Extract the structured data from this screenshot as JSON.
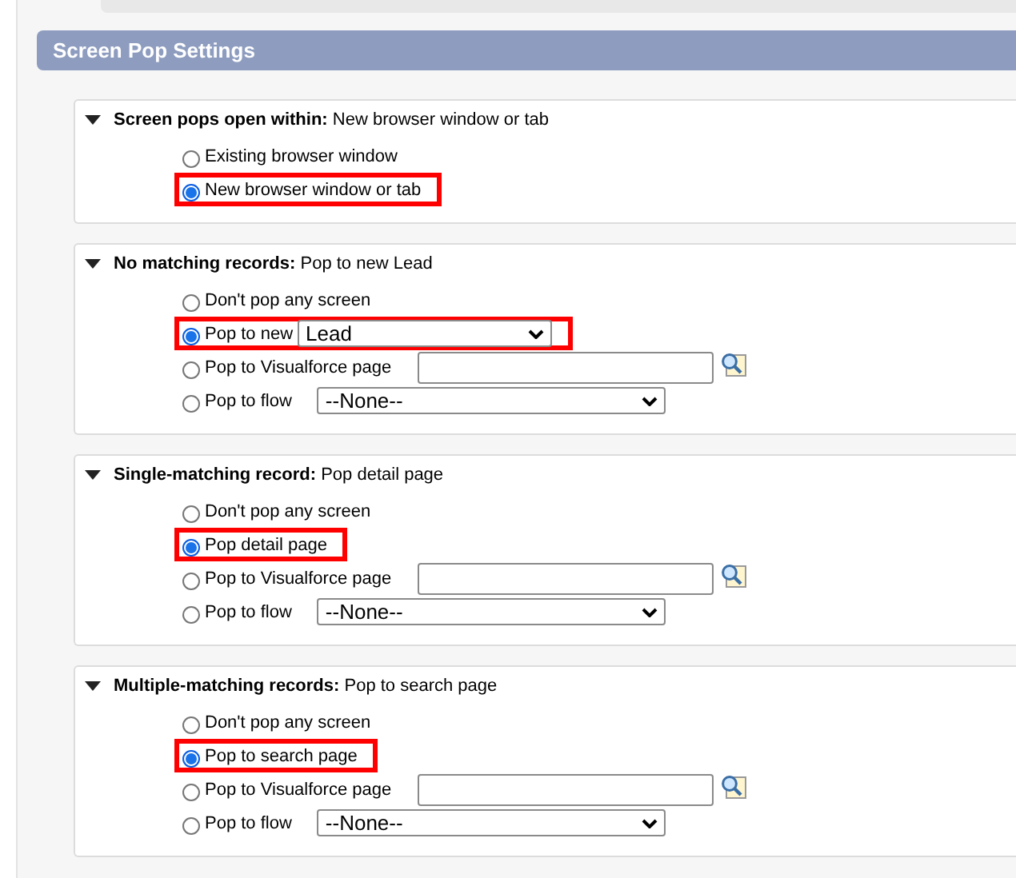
{
  "header": {
    "title": "Screen Pop Settings"
  },
  "sections": [
    {
      "label": "Screen pops open within:",
      "value": "New browser window or tab",
      "expanded": true,
      "options": [
        {
          "kind": "plain",
          "label": "Existing browser window",
          "selected": false,
          "highlighted": false
        },
        {
          "kind": "plain",
          "label": "New browser window or tab",
          "selected": true,
          "highlighted": true
        }
      ]
    },
    {
      "label": "No matching records:",
      "value": "Pop to new Lead",
      "expanded": true,
      "options": [
        {
          "kind": "plain",
          "label": "Don't pop any screen",
          "selected": false,
          "highlighted": false
        },
        {
          "kind": "object_select",
          "label": "Pop to new",
          "value": "Lead",
          "selected": true,
          "highlighted": true
        },
        {
          "kind": "lookup",
          "label": "Pop to Visualforce page",
          "selected": false,
          "highlighted": false
        },
        {
          "kind": "flow_select",
          "label": "Pop to flow",
          "value": "--None--",
          "selected": false,
          "highlighted": false
        }
      ]
    },
    {
      "label": "Single-matching record:",
      "value": "Pop detail page",
      "expanded": true,
      "options": [
        {
          "kind": "plain",
          "label": "Don't pop any screen",
          "selected": false,
          "highlighted": false
        },
        {
          "kind": "plain",
          "label": "Pop detail page",
          "selected": true,
          "highlighted": true
        },
        {
          "kind": "lookup",
          "label": "Pop to Visualforce page",
          "selected": false,
          "highlighted": false
        },
        {
          "kind": "flow_select",
          "label": "Pop to flow",
          "value": "--None--",
          "selected": false,
          "highlighted": false
        }
      ]
    },
    {
      "label": "Multiple-matching records:",
      "value": "Pop to search page",
      "expanded": true,
      "options": [
        {
          "kind": "plain",
          "label": "Don't pop any screen",
          "selected": false,
          "highlighted": false
        },
        {
          "kind": "plain",
          "label": "Pop to search page",
          "selected": true,
          "highlighted": true
        },
        {
          "kind": "lookup",
          "label": "Pop to Visualforce page",
          "selected": false,
          "highlighted": false
        },
        {
          "kind": "flow_select",
          "label": "Pop to flow",
          "value": "--None--",
          "selected": false,
          "highlighted": false
        }
      ]
    }
  ]
}
